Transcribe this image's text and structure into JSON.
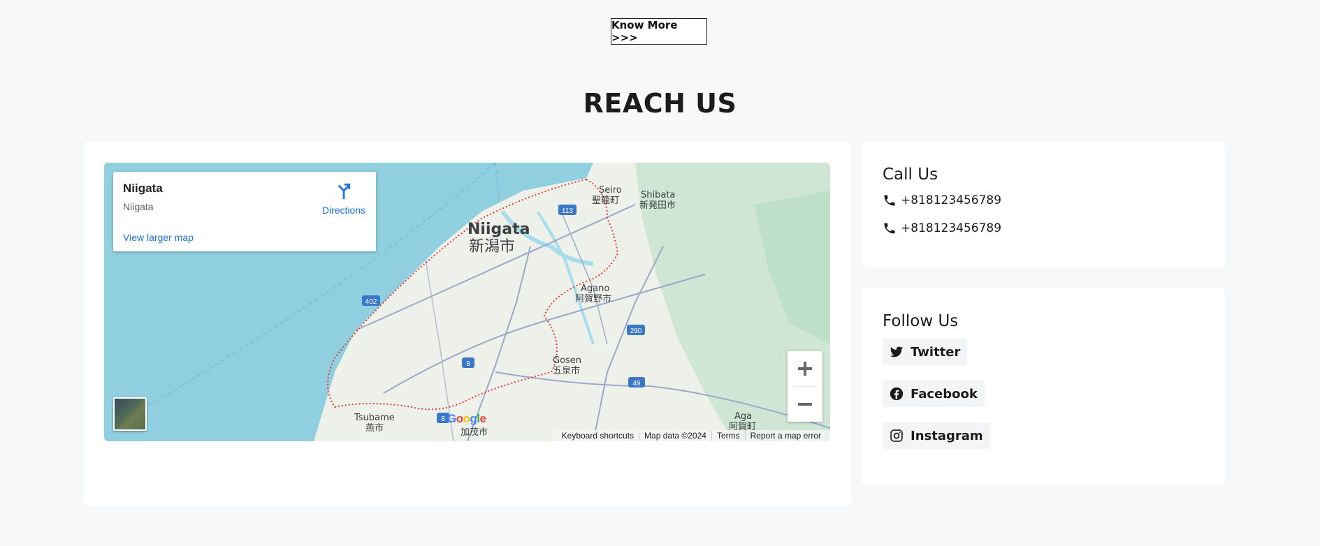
{
  "top": {
    "know_more_label": "Know More >>>"
  },
  "section": {
    "heading": "REACH US"
  },
  "map": {
    "info_title": "Niigata",
    "info_subtitle": "Niigata",
    "directions_label": "Directions",
    "view_larger_label": "View larger map",
    "labels": {
      "niigata_en": "Niigata",
      "niigata_jp": "新潟市",
      "seiro_en": "Seiro",
      "seiro_jp": "聖籠町",
      "shibata_en": "Shibata",
      "shibata_jp": "新発田市",
      "agano_en": "Agano",
      "agano_jp": "阿賀野市",
      "gosen_en": "Gosen",
      "gosen_jp": "五泉市",
      "tsubame_en": "Tsubame",
      "tsubame_jp": "燕市",
      "kamo_jp": "加茂市",
      "aga_en": "Aga",
      "aga_jp": "阿賀町"
    },
    "route_shields": [
      "113",
      "402",
      "290",
      "8",
      "49",
      "8"
    ],
    "google_logo": "Google",
    "attribution": {
      "shortcuts": "Keyboard shortcuts",
      "map_data": "Map data ©2024",
      "terms": "Terms",
      "report": "Report a map error"
    }
  },
  "call_us": {
    "title": "Call Us",
    "phones": [
      "+818123456789",
      "+818123456789"
    ]
  },
  "follow_us": {
    "title": "Follow Us",
    "links": [
      {
        "label": "Twitter",
        "icon": "twitter-icon"
      },
      {
        "label": "Facebook",
        "icon": "facebook-icon"
      },
      {
        "label": "Instagram",
        "icon": "instagram-icon"
      }
    ]
  },
  "colors": {
    "page_bg": "#f7f8fa",
    "card_bg": "#ffffff",
    "sea": "#8fcfe0",
    "land": "#eef0ea",
    "forest": "#cfe6d4",
    "link_blue": "#1a73e8",
    "boundary_red": "#e53935",
    "route_shield": "#3b78c8"
  }
}
